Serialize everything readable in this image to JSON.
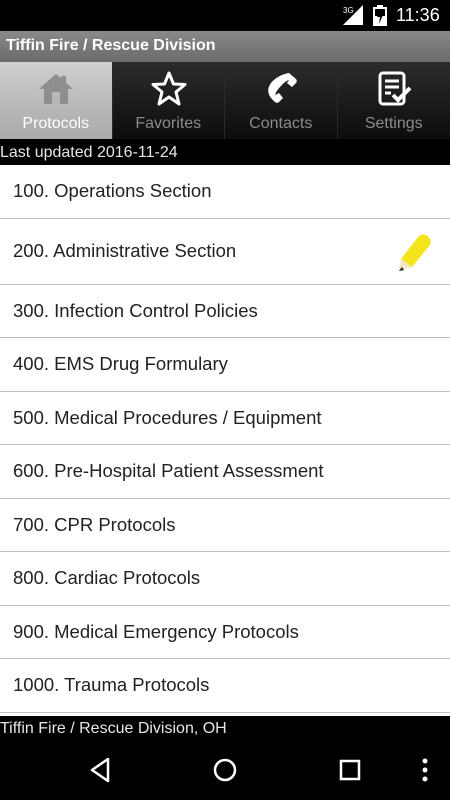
{
  "status_bar": {
    "network_label": "3G",
    "time": "11:36"
  },
  "app": {
    "title": "Tiffin Fire / Rescue Division"
  },
  "tabs": [
    {
      "label": "Protocols",
      "icon": "home-icon",
      "active": true
    },
    {
      "label": "Favorites",
      "icon": "star-icon",
      "active": false
    },
    {
      "label": "Contacts",
      "icon": "phone-icon",
      "active": false
    },
    {
      "label": "Settings",
      "icon": "settings-checklist-icon",
      "active": false
    }
  ],
  "last_updated": "Last updated 2016-11-24",
  "protocols": [
    {
      "label": "100. Operations Section"
    },
    {
      "label": "200. Administrative Section",
      "has_edit_icon": true
    },
    {
      "label": "300. Infection Control Policies"
    },
    {
      "label": "400. EMS Drug Formulary"
    },
    {
      "label": "500. Medical Procedures / Equipment"
    },
    {
      "label": "600. Pre-Hospital Patient Assessment"
    },
    {
      "label": "700. CPR Protocols"
    },
    {
      "label": "800. Cardiac Protocols"
    },
    {
      "label": "900. Medical Emergency Protocols"
    },
    {
      "label": "1000. Trauma Protocols"
    }
  ],
  "footer": {
    "text": "Tiffin Fire / Rescue Division, OH"
  },
  "colors": {
    "edit_icon": "#f4e41c",
    "active_tab": "#bdbdbd",
    "divider": "#bdbdbd"
  }
}
